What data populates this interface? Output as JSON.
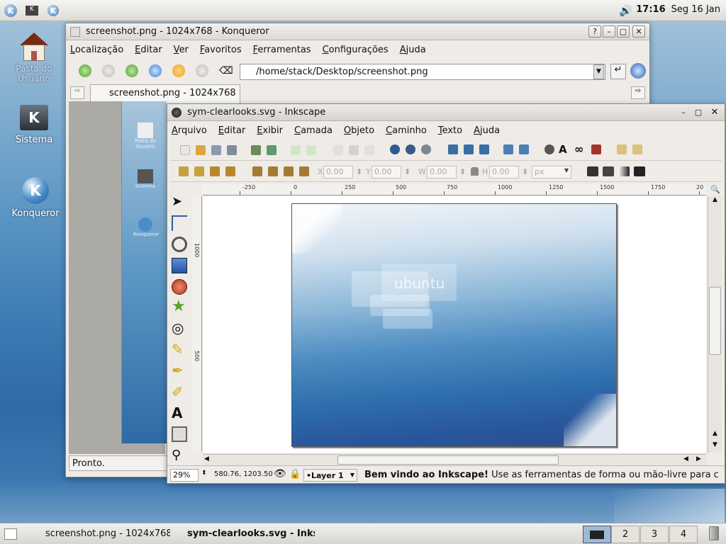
{
  "panel": {
    "time": "17:16",
    "date": "Seg 16 Jan"
  },
  "desktop_icons": [
    {
      "label": "Pasta do Usuário"
    },
    {
      "label": "Sistema"
    },
    {
      "label": "Konqueror"
    }
  ],
  "konqueror": {
    "title": "screenshot.png - 1024x768 - Konqueror",
    "menu": [
      "Localização",
      "Editar",
      "Ver",
      "Favoritos",
      "Ferramentas",
      "Configurações",
      "Ajuda"
    ],
    "url": "/home/stack/Desktop/screenshot.png",
    "tab": "screenshot.png - 1024x768",
    "status": "Pronto.",
    "inner_icons": [
      "Pasta do Usuário",
      "Sistema",
      "Konqueror"
    ]
  },
  "inkscape": {
    "title": "sym-clearlooks.svg - Inkscape",
    "menu": [
      "Arquivo",
      "Editar",
      "Exibir",
      "Camada",
      "Objeto",
      "Caminho",
      "Texto",
      "Ajuda"
    ],
    "x_label": "X",
    "x_value": "0.00",
    "y_label": "Y",
    "y_value": "0.00",
    "w_label": "W",
    "w_value": "0.00",
    "h_label": "H",
    "h_value": "0.00",
    "unit": "px",
    "ruler_labels": [
      "-250",
      "0",
      "250",
      "500",
      "750",
      "1000",
      "1250",
      "1500",
      "1750",
      "20"
    ],
    "vruler_labels": [
      "1000",
      "500"
    ],
    "canvas_logo": "ubuntu",
    "zoom": "29%",
    "coords": "580.76, 1203.50",
    "layer": "•Layer 1",
    "status_bold": "Bem vindo ao Inkscape!",
    "status_text": " Use as ferramentas de forma ou mão-livre para c"
  },
  "taskbar": {
    "tasks": [
      "screenshot.png - 1024x768",
      "sym-clearlooks.svg - Inks"
    ],
    "desktops": [
      "2",
      "3",
      "4"
    ]
  }
}
